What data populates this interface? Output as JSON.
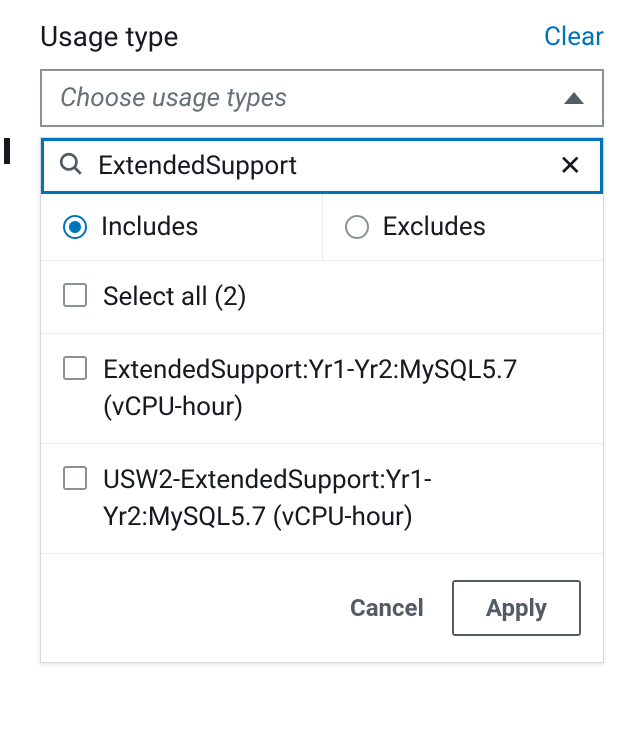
{
  "header": {
    "title": "Usage type",
    "clear_label": "Clear"
  },
  "combo": {
    "placeholder": "Choose usage types"
  },
  "search": {
    "value": "ExtendedSupport"
  },
  "filter_mode": {
    "includes_label": "Includes",
    "excludes_label": "Excludes",
    "selected": "includes"
  },
  "options": {
    "select_all_label": "Select all (2)",
    "items": [
      {
        "label": "ExtendedSupport:Yr1-Yr2:MySQL5.7 (vCPU-hour)",
        "checked": false
      },
      {
        "label": "USW2-ExtendedSupport:Yr1-Yr2:MySQL5.7 (vCPU-hour)",
        "checked": false
      }
    ]
  },
  "footer": {
    "cancel_label": "Cancel",
    "apply_label": "Apply"
  }
}
